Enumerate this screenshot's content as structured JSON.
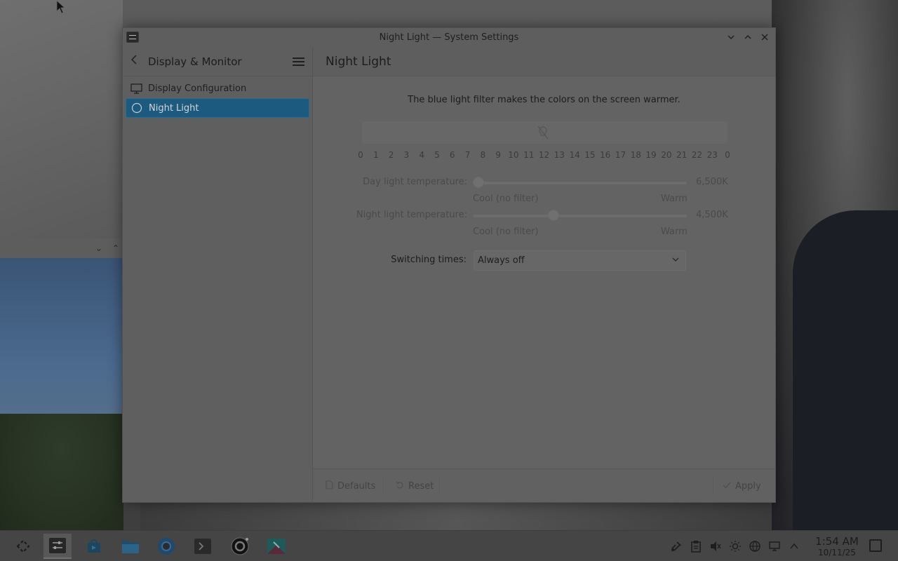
{
  "window": {
    "title": "Night Light — System Settings",
    "minimize_icon": "chevron-down-icon",
    "maximize_icon": "chevron-up-icon",
    "close_icon": "close-icon"
  },
  "sidebar": {
    "title": "Display & Monitor",
    "items": [
      {
        "label": "Display Configuration",
        "icon": "monitor-icon",
        "active": false
      },
      {
        "label": "Night Light",
        "icon": "night-light-icon",
        "active": true
      }
    ]
  },
  "content": {
    "title": "Night Light",
    "description": "The blue light filter makes the colors on the screen warmer.",
    "hours": [
      "0",
      "1",
      "2",
      "3",
      "4",
      "5",
      "6",
      "7",
      "8",
      "9",
      "10",
      "11",
      "12",
      "13",
      "14",
      "15",
      "16",
      "17",
      "18",
      "19",
      "20",
      "21",
      "22",
      "23",
      "0"
    ],
    "day_temp": {
      "label": "Day light temperature:",
      "value": "6,500K",
      "left": "Cool (no filter)",
      "right": "Warm",
      "level": 0.0
    },
    "night_temp": {
      "label": "Night light temperature:",
      "value": "4,500K",
      "left": "Cool (no filter)",
      "right": "Warm",
      "level": 0.37
    },
    "switching": {
      "label": "Switching times:",
      "value": "Always off"
    }
  },
  "footer": {
    "defaults": "Defaults",
    "reset": "Reset",
    "apply": "Apply"
  },
  "taskbar": {
    "apps": [
      {
        "name": "app-launcher-icon"
      },
      {
        "name": "system-settings-icon",
        "active": true
      },
      {
        "name": "discover-store-icon"
      },
      {
        "name": "file-manager-icon"
      },
      {
        "name": "chromium-icon"
      },
      {
        "name": "terminal-icon"
      },
      {
        "name": "obs-icon"
      },
      {
        "name": "image-viewer-icon"
      }
    ],
    "time": "1:54 AM",
    "date": "10/11/25"
  },
  "colors": {
    "accent": "#1d5a80"
  }
}
